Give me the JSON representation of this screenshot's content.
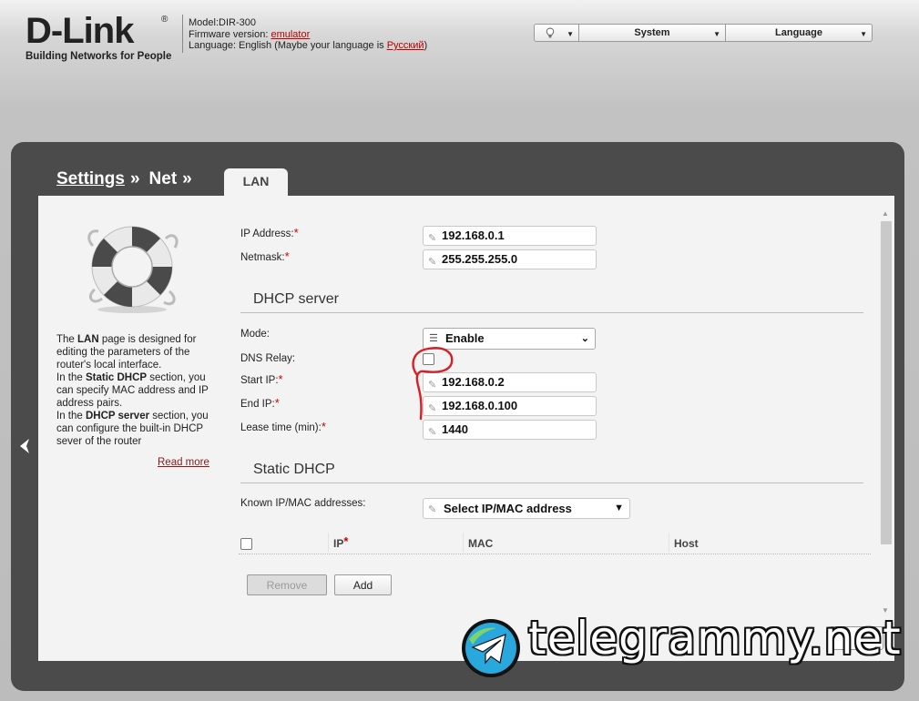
{
  "header": {
    "logo_text": "D-Link",
    "logo_reg": "®",
    "logo_tagline": "Building Networks for People",
    "model_label": "Model:",
    "model_value": "DIR-300",
    "firmware_label": "Firmware version: ",
    "firmware_value": "emulator",
    "language_label": "Language: English (Maybe your language is ",
    "language_link": "Русский",
    "language_close": ")"
  },
  "topbar": {
    "system_label": "System",
    "language_label": "Language"
  },
  "breadcrumb": {
    "settings": "Settings",
    "net": "Net",
    "separator": "»",
    "active_tab": "LAN"
  },
  "help": {
    "p1_pre": "The ",
    "p1_bold": "LAN",
    "p1_post": " page is designed for editing the parameters of the router's local interface.",
    "p2_pre": "In the ",
    "p2_bold": "Static DHCP",
    "p2_post": " section, you can specify MAC address and IP address pairs.",
    "p3_pre": "In the ",
    "p3_bold": "DHCP server",
    "p3_post": " section, you can configure the built-in DHCP sever of the router",
    "read_more": "Read more"
  },
  "form": {
    "ip_label": "IP Address:",
    "ip_value": "192.168.0.1",
    "netmask_label": "Netmask:",
    "netmask_value": "255.255.255.0",
    "required_mark": "*",
    "dhcp_section": "DHCP server",
    "mode_label": "Mode:",
    "mode_value": "Enable",
    "dns_relay_label": "DNS Relay:",
    "start_ip_label": "Start IP:",
    "start_ip_value": "192.168.0.2",
    "end_ip_label": "End IP:",
    "end_ip_value": "192.168.0.100",
    "lease_label": "Lease time (min):",
    "lease_value": "1440",
    "static_section": "Static DHCP",
    "known_label": "Known IP/MAC addresses:",
    "known_value": "Select IP/MAC address",
    "col_ip": "IP",
    "col_mac": "MAC",
    "col_host": "Host",
    "remove_button": "Remove",
    "add_button": "Add"
  },
  "watermark": {
    "text": "telegrammy.net"
  },
  "colors": {
    "frame": "#4b4b4b",
    "panel": "#f3f3f3",
    "link_red": "#b00000",
    "annotation": "#d81f26"
  }
}
